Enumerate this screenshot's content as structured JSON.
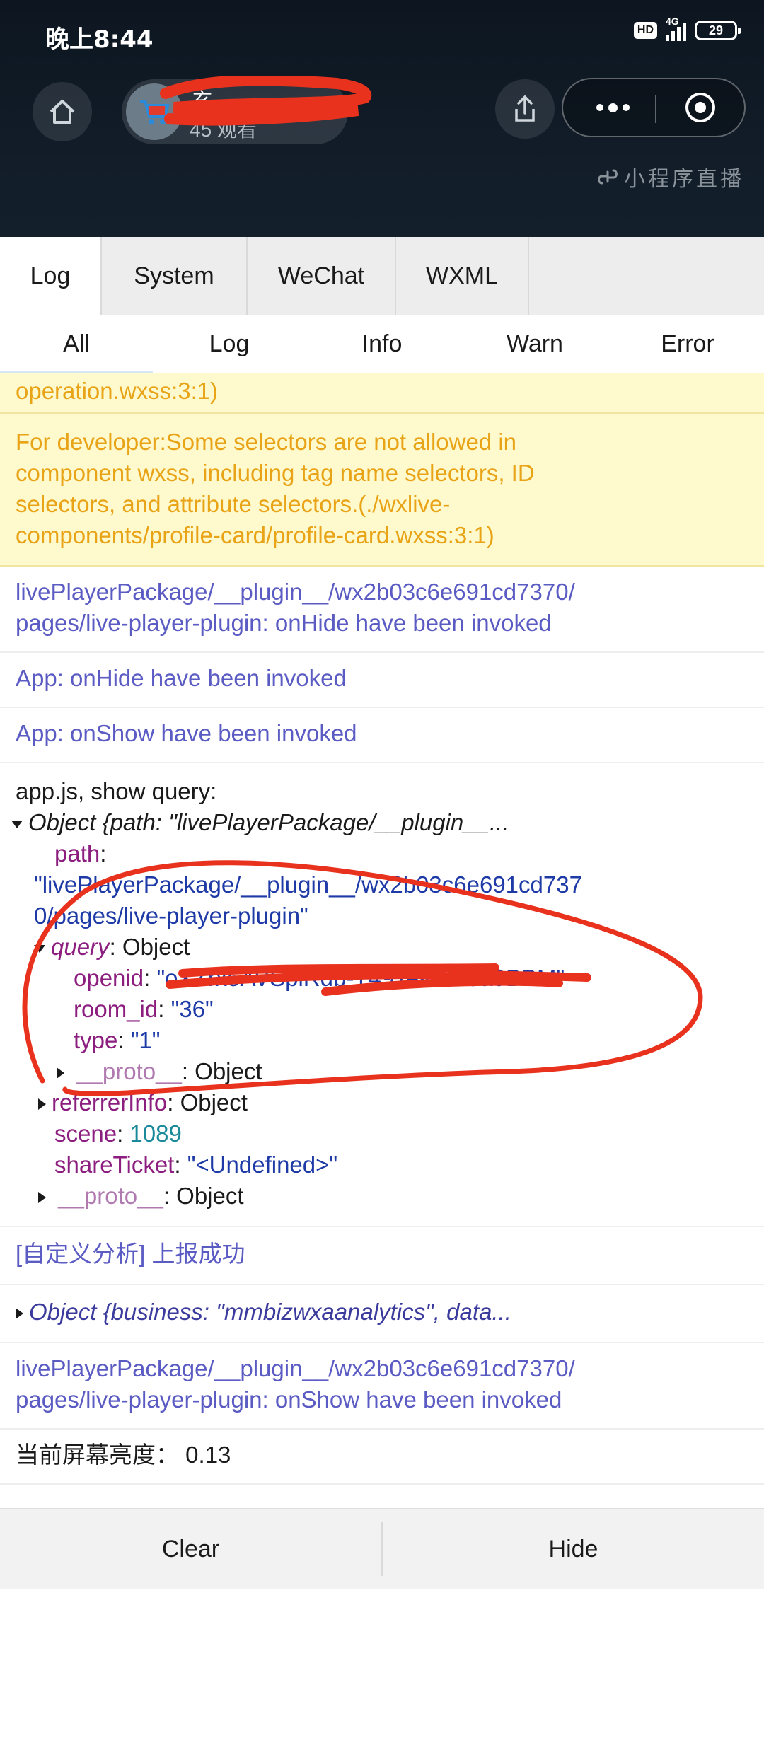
{
  "status_bar": {
    "time": "晚上8:44",
    "hd": "HD",
    "network": "4G",
    "battery": "29"
  },
  "header": {
    "room_name": "玄",
    "viewers": "45 观看",
    "mini_program_label": "小程序直播"
  },
  "tabs": [
    "Log",
    "System",
    "WeChat",
    "WXML"
  ],
  "filters": [
    "All",
    "Log",
    "Info",
    "Warn",
    "Error"
  ],
  "logs": {
    "warn1": "operation.wxss:3:1)",
    "warn2": [
      "For developer:Some selectors are not allowed in",
      "component wxss, including tag name selectors, ID",
      "selectors, and attribute selectors.(./wxlive-",
      "components/profile-card/profile-card.wxss:3:1)"
    ],
    "info1": [
      "livePlayerPackage/__plugin__/wx2b03c6e691cd7370/",
      "pages/live-player-plugin: onHide have been invoked"
    ],
    "info2": "App: onHide have been invoked",
    "info3": "App: onShow have been invoked",
    "query": {
      "title": "app.js, show query:",
      "object_summary": "Object {path: \"livePlayerPackage/__plugin__...",
      "path_key": "path",
      "path_value_1": "\"livePlayerPackage/__plugin__/wx2b03c6e691cd737",
      "path_value_2": "0/pages/live-player-plugin\"",
      "query_key": "query",
      "query_type": "Object",
      "openid_key": "openid",
      "openid_value": "\"oXZrx5AVSpiRdb-T49TeKi6Z5a9BBM\"",
      "room_key": "room_id",
      "room_value": "\"36\"",
      "type_key": "type",
      "type_value": "\"1\"",
      "proto_key": "__proto__",
      "proto_value": "Object",
      "referrer_key": "referrerInfo",
      "referrer_value": "Object",
      "scene_key": "scene",
      "scene_value": "1089",
      "share_key": "shareTicket",
      "share_value": "\"<Undefined>\"",
      "proto2_key": "__proto__",
      "proto2_value": "Object"
    },
    "info4": "[自定义分析] 上报成功",
    "object2": "Object {business: \"mmbizwxaanalytics\", data...",
    "info5": [
      "livePlayerPackage/__plugin__/wx2b03c6e691cd7370/",
      "pages/live-player-plugin: onShow have been invoked"
    ],
    "brightness": "当前屏幕亮度： 0.13"
  },
  "footer": {
    "clear": "Clear",
    "hide": "Hide"
  },
  "colors": {
    "warn_bg": "#fffacd",
    "warn_text": "#e8a317",
    "info_text": "#5b5bc4",
    "annotation_red": "#e8321e"
  }
}
